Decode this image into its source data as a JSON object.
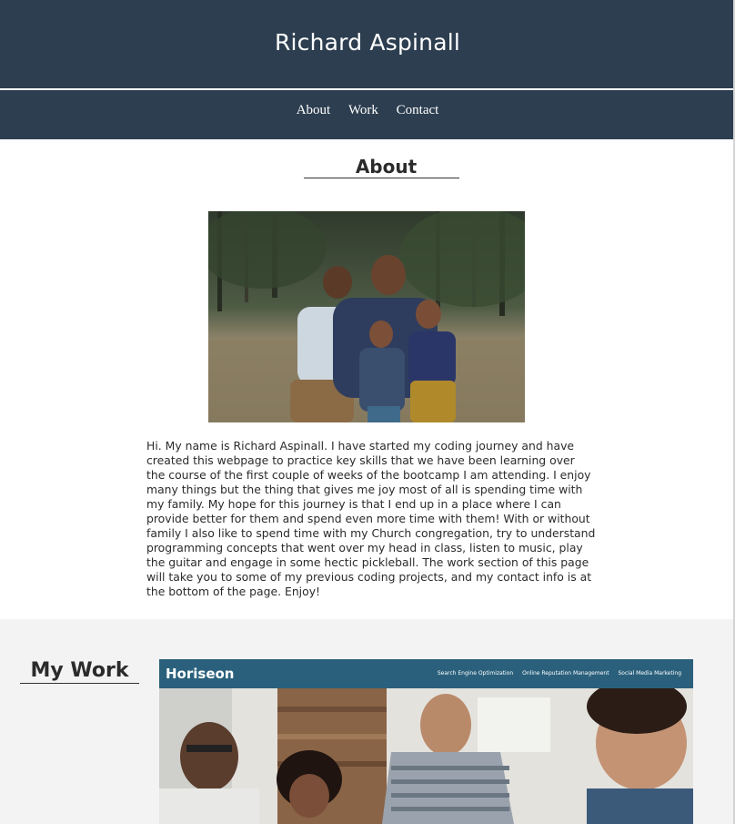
{
  "header": {
    "title": "Richard Aspinall"
  },
  "nav": {
    "items": [
      "About",
      "Work",
      "Contact"
    ]
  },
  "about": {
    "heading": "About",
    "photo_alt": "family-photo",
    "bio": "Hi. My name is Richard Aspinall. I have started my coding journey and have created this webpage to practice key skills that we have been learning over the course of the first couple of weeks of the bootcamp I am attending. I enjoy many things but the thing that gives me joy most of all is spending time with my family. My hope for this journey is that I end up in a place where I can provide better for them and spend even more time with them! With or without family I also like to spend time with my Church congregation, try to understand programming concepts that went over my head in class, listen to music, play the guitar and engage in some hectic pickleball. The work section of this page will take you to some of my previous coding projects, and my contact info is at the bottom of the page. Enjoy!"
  },
  "work": {
    "heading": "My Work",
    "project": {
      "brand": "Horiseon",
      "links": [
        "Search Engine Optimization",
        "Online Reputation Management",
        "Social Media Marketing"
      ]
    }
  },
  "colors": {
    "header_bg": "#2d3e50",
    "section_bg": "#f3f3f3",
    "project_bar": "#2a607c"
  }
}
